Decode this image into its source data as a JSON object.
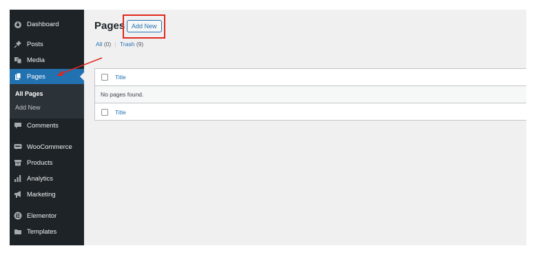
{
  "sidebar": {
    "items": [
      {
        "label": "Dashboard",
        "icon": "dashboard-icon"
      },
      {
        "label": "Posts",
        "icon": "pin-icon"
      },
      {
        "label": "Media",
        "icon": "media-icon"
      },
      {
        "label": "Pages",
        "icon": "page-icon"
      },
      {
        "label": "Comments",
        "icon": "comment-icon"
      },
      {
        "label": "WooCommerce",
        "icon": "woocommerce-icon"
      },
      {
        "label": "Products",
        "icon": "archive-icon"
      },
      {
        "label": "Analytics",
        "icon": "bar-chart-icon"
      },
      {
        "label": "Marketing",
        "icon": "megaphone-icon"
      },
      {
        "label": "Elementor",
        "icon": "elementor-icon"
      },
      {
        "label": "Templates",
        "icon": "folder-icon"
      }
    ],
    "submenu": [
      "All Pages",
      "Add New"
    ]
  },
  "header": {
    "title": "Pages",
    "add_new_label": "Add New"
  },
  "filters": {
    "all_label": "All",
    "all_count": "(0)",
    "separator": "|",
    "trash_label": "Trash",
    "trash_count": "(9)"
  },
  "table": {
    "header_title": "Title",
    "empty_message": "No pages found.",
    "footer_title": "Title"
  },
  "colors": {
    "sidebar_bg": "#1d2327",
    "active_bg": "#2271b1",
    "link": "#2271b1",
    "highlight": "#e1261c",
    "canvas_bg": "#f0f0f1"
  }
}
